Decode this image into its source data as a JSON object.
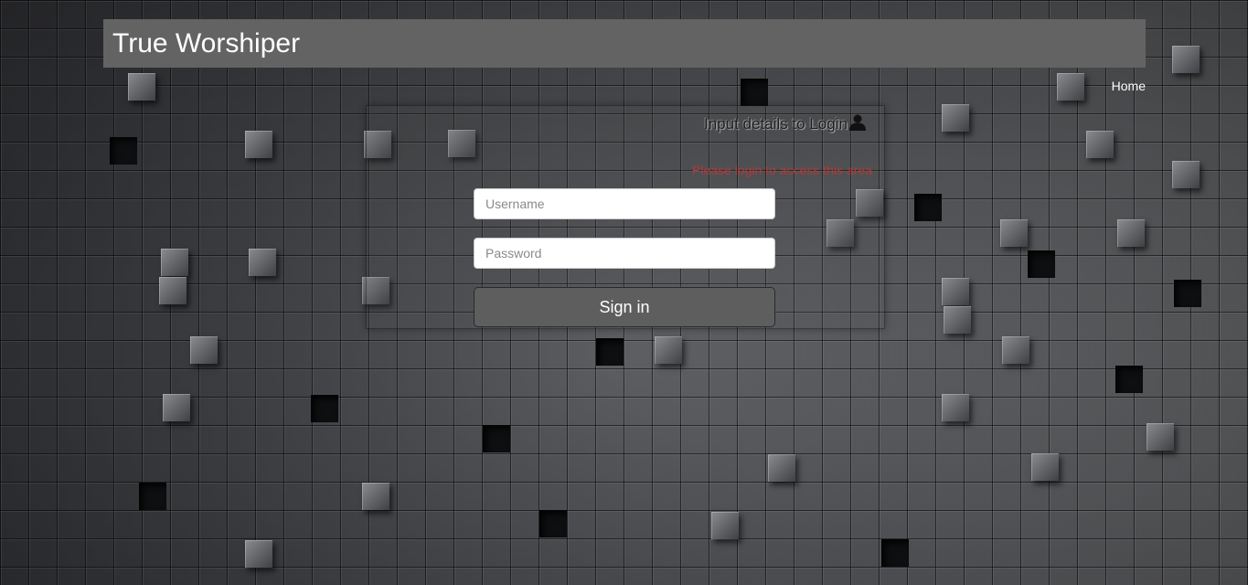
{
  "header": {
    "brand": "True Worshiper"
  },
  "nav": {
    "home_label": "Home"
  },
  "login": {
    "title": "Input details to Login",
    "title_icon": "user-icon",
    "warning": "Please login to access this area",
    "username_placeholder": "Username",
    "password_placeholder": "Password",
    "submit_label": "Sign in"
  },
  "colors": {
    "header_bg": "#636363",
    "warning_text": "#b23838",
    "button_bg": "#5e5e5e"
  }
}
